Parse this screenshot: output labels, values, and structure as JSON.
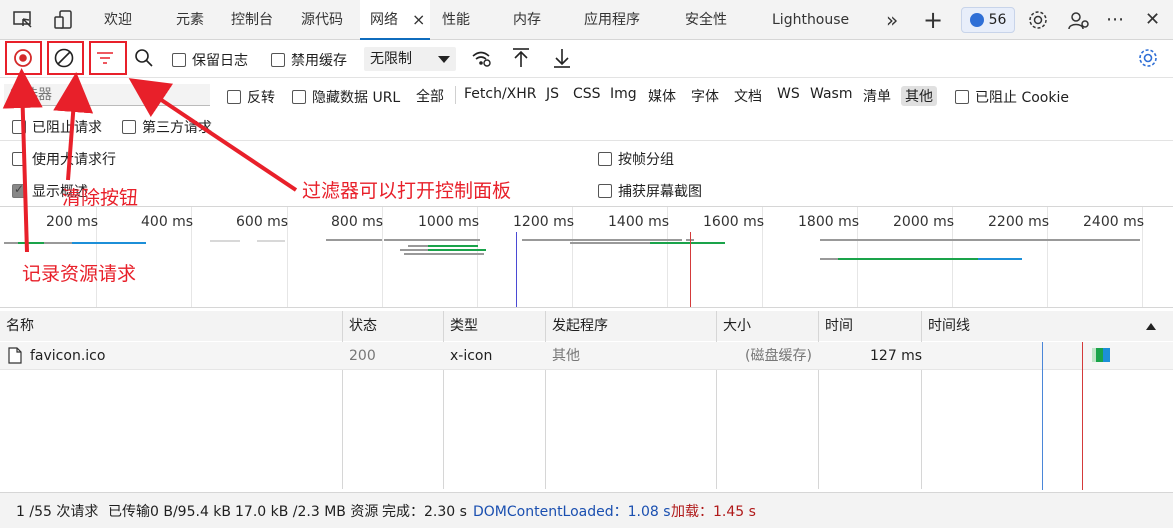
{
  "tabs": [
    {
      "label": "欢迎"
    },
    {
      "label": "元素"
    },
    {
      "label": "控制台"
    },
    {
      "label": "源代码"
    },
    {
      "label": "网络",
      "close": "×"
    },
    {
      "label": "性能"
    },
    {
      "label": "内存"
    },
    {
      "label": "应用程序"
    },
    {
      "label": "安全性"
    },
    {
      "label": "Lighthouse"
    }
  ],
  "tabbar": {
    "more": "»",
    "add": "+",
    "issues_count": "56",
    "menu": "⋯",
    "close": "✕"
  },
  "toolbar": {
    "preserve_log": "保留日志",
    "disable_cache": "禁用缓存",
    "throttle": "无限制"
  },
  "filter": {
    "placeholder": "筛选器",
    "invert": "反转",
    "hide_data_url": "隐藏数据 URL",
    "types": [
      "全部",
      "Fetch/XHR",
      "JS",
      "CSS",
      "Img",
      "媒体",
      "字体",
      "文档",
      "WS",
      "Wasm",
      "清单",
      "其他"
    ],
    "selected_type": "其他",
    "blocked_cookies": "已阻止 Cookie",
    "blocked_requests": "已阻止请求",
    "third_party": "第三方请求"
  },
  "settings": {
    "large_rows": "使用大请求行",
    "group_by_frame": "按帧分组",
    "show_overview": "显示概述",
    "capture_screenshots": "捕获屏幕截图"
  },
  "overview": {
    "ticks": [
      "200 ms",
      "400 ms",
      "600 ms",
      "800 ms",
      "1000 ms",
      "1200 ms",
      "1400 ms",
      "1600 ms",
      "1800 ms",
      "2000 ms",
      "2200 ms",
      "2400 ms"
    ],
    "dom_line_color": "#4a4ad4",
    "load_line_color": "#d43a3a"
  },
  "table": {
    "headers": [
      "名称",
      "状态",
      "类型",
      "发起程序",
      "大小",
      "时间",
      "时间线"
    ],
    "rows": [
      {
        "name": "favicon.ico",
        "status": "200",
        "type": "x-icon",
        "initiator": "其他",
        "size": "(磁盘缓存)",
        "time": "127 ms"
      }
    ]
  },
  "status": {
    "requests": "1 /55 次请求",
    "transferred": "已传输0 B/95.4 kB",
    "resources": "17.0 kB /2.3 MB 资源",
    "finish": "完成：2.30 s",
    "dcl": "DOMContentLoaded：1.08 s",
    "load": "加载：1.45 s",
    "dcl_color": "#1a4fb0",
    "load_color": "#b01a1a"
  },
  "annotations": {
    "record": "记录资源请求",
    "clear": "清除按钮",
    "filter": "过滤器可以打开控制面板",
    "color": "#e8202a"
  }
}
